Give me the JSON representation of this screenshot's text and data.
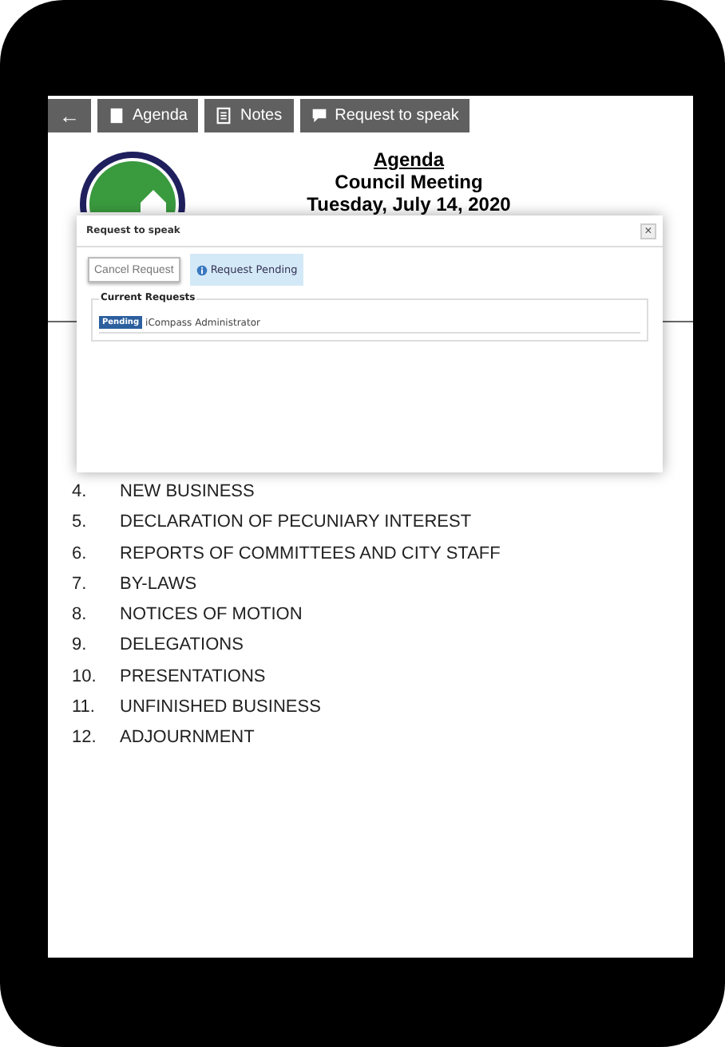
{
  "toolbar": [
    {
      "kind": "back",
      "label": "←"
    },
    {
      "kind": "agenda",
      "label": "Agenda"
    },
    {
      "kind": "notes",
      "label": "Notes"
    },
    {
      "kind": "speak",
      "label": "Request to speak"
    }
  ],
  "header": {
    "title": "Agenda",
    "subtitle": "Council Meeting",
    "date": "Tuesday, July 14, 2020"
  },
  "agenda_items": [
    {
      "number": "4.",
      "title": "NEW BUSINESS"
    },
    {
      "number": "5.",
      "title": "DECLARATION OF PECUNIARY INTEREST"
    },
    {
      "number": "6.",
      "title": "REPORTS OF COMMITTEES AND CITY STAFF"
    },
    {
      "number": "7.",
      "title": "BY-LAWS"
    },
    {
      "number": "8.",
      "title": "NOTICES OF MOTION"
    },
    {
      "number": "9.",
      "title": "DELEGATIONS"
    },
    {
      "number": "10.",
      "title": "PRESENTATIONS"
    },
    {
      "number": "11.",
      "title": "UNFINISHED BUSINESS"
    },
    {
      "number": "12.",
      "title": "ADJOURNMENT"
    }
  ],
  "dialog": {
    "title": "Request to speak",
    "close": "×",
    "cancel_button": "Cancel Request",
    "status": "Request Pending",
    "section_title": "Current Requests",
    "requests": [
      {
        "badge": "Pending",
        "name": "iCompass Administrator"
      }
    ]
  }
}
